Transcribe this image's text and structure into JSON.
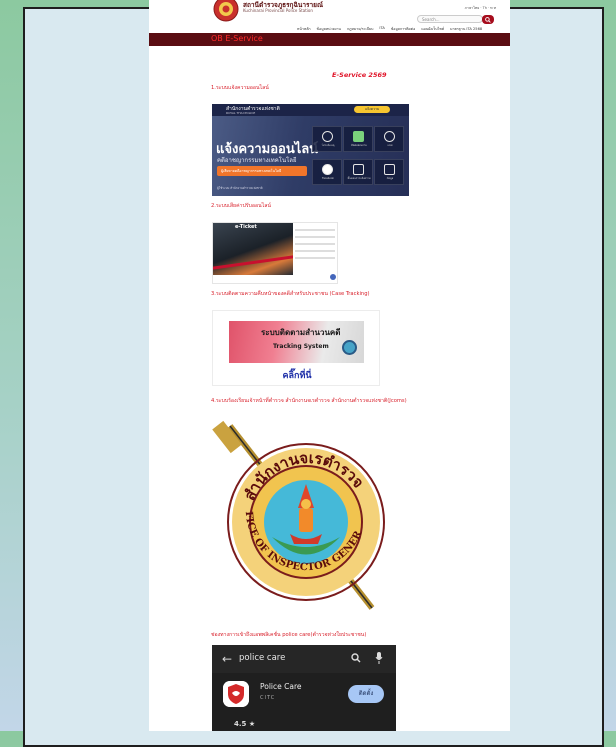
{
  "header": {
    "site_title": "สถานีตำรวจภูธรกุฉินารายณ์",
    "site_subtitle": "Kuchinarai Provincial Police Station",
    "util_links": "ภาษาไทย · Th · ท ท",
    "search_placeholder": "Search...",
    "nav": [
      "หน้าหลัก",
      "ข้อมูลหน่วยงาน",
      "กฎหมาย/ระเบียบ",
      "ITA",
      "ข้อมูลการติดต่อ",
      "แผนผังเว็บไซต์",
      "มาตรฐาน ITA 2568"
    ]
  },
  "page_heading": "OB E-Service",
  "content": {
    "eservice_title": "E-Service 2569",
    "sections": [
      "1.ระบบแจ้งความออนไลน์",
      "2.ระบบเสียค่าปรับออนไลน์",
      "3.ระบบติดตามความคืบหน้าของคดีสำหรับประชาชน (Case Tracking)",
      "4.ระบบร้องเรียนเจ้าหน้าที่ตำรวจ สำนักงานจเรตำรวจ สำนักงานตำรวจแห่งชาติ(Jcoms)",
      "ช่องทางการเข้าถึงแอพพลิเคชั่น police care(ตำรวจห่วงใยประชาชน)"
    ]
  },
  "images": {
    "online_report": {
      "org_name": "สำนักงานตำรวจแห่งชาติ",
      "org_name_en": "ROYAL THAI POLICE",
      "pill": "แจ้งความ",
      "headline": "แจ้งความออนไลน์",
      "subline": "คดีอาชญากรรมทางเทคโนโลยี",
      "orange_bar": "ผู้เสียหายคดีอาชญากรรมทางเทคโนโลยี",
      "footer_note": "ผู้ใช้ระบบ สำนักงานตำรวจแห่งชาติ",
      "tiles": [
        {
          "icon": "phone-icon",
          "label": "โทรแจ้งเหตุ"
        },
        {
          "icon": "line-icon",
          "label": "ติดต่อสอบถาม"
        },
        {
          "icon": "chat-icon",
          "label": "แชท"
        },
        {
          "icon": "facebook-icon",
          "label": "Facebook"
        },
        {
          "icon": "document-icon",
          "label": "ขั้นตอนการแจ้งความ"
        },
        {
          "icon": "info-icon",
          "label": "ข้อมูล"
        }
      ]
    },
    "eticket": {
      "label": "e-Ticket"
    },
    "tracking": {
      "thai_title": "ระบบติดตามสำนวนคดี",
      "english_title": "Tracking System",
      "click_text": "คลิ๊กที่นี่"
    },
    "oig_seal": {
      "thai_arc": "สำนักงานจเรตำรวจ",
      "english_arc": "OFFICE OF INSPECTOR GENERAL"
    },
    "police_care": {
      "search_query": "police care",
      "app_name": "Police Care",
      "developer": "CITC",
      "install_label": "ติดตั้ง",
      "rating": "4.5 ★",
      "icon_text": "POLICE CARE"
    }
  },
  "colors": {
    "header_bar": "#5a0d12",
    "heading_red": "#ff2a2a",
    "section_red": "#d81f2a",
    "search_button": "#a60d1d"
  }
}
